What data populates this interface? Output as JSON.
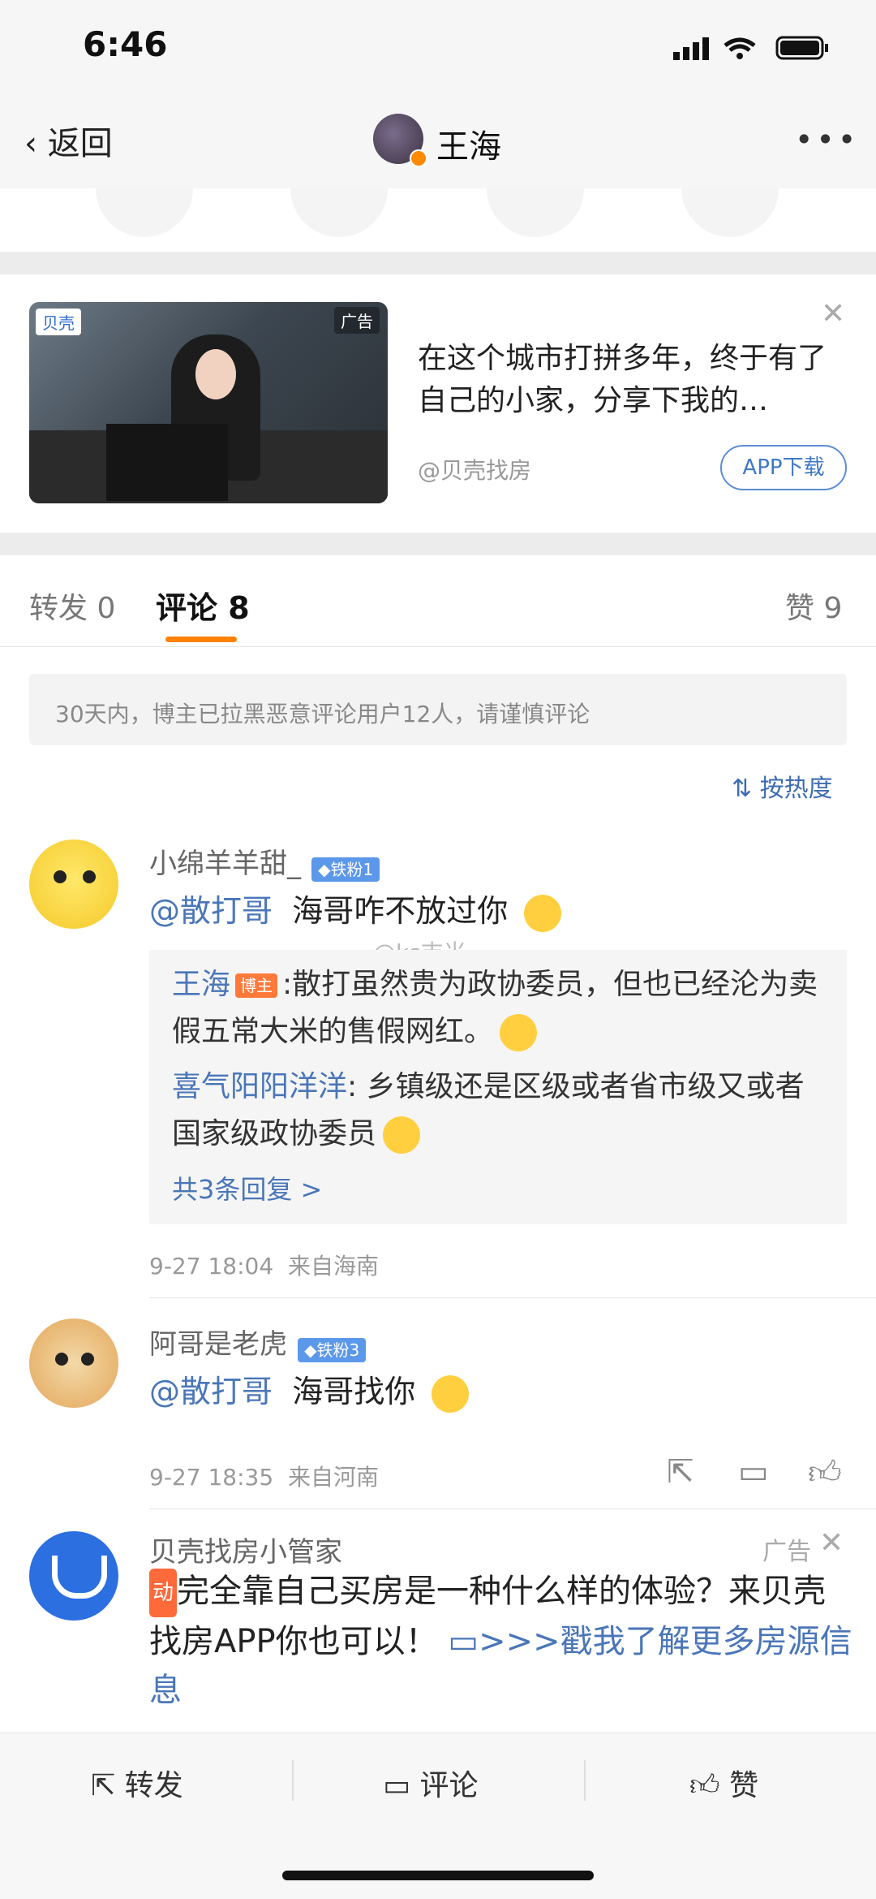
{
  "status_bar": {
    "time": "6:46"
  },
  "nav": {
    "back_label": "返回",
    "title": "王海",
    "more": "•••"
  },
  "ad_card": {
    "logo": "贝壳",
    "ad_tag": "广告",
    "text": "在这个城市打拼多年，终于有了自己的小家，分享下我的…",
    "source": "@贝壳找房",
    "button": "APP下载"
  },
  "tabs": {
    "forward": "转发 0",
    "comments": "评论 8",
    "likes": "赞 9"
  },
  "notice": "30天内，博主已拉黑恶意评论用户12人，请谨慎评论",
  "sort_label": "按热度",
  "watermark": "@ks吉米",
  "comments": [
    {
      "user": "小绵羊羊甜_",
      "badge": "◆铁粉1",
      "mention": "@散打哥",
      "text": "海哥咋不放过你",
      "replies": [
        {
          "user": "王海",
          "host_badge": "博主",
          "text": ":散打虽然贵为政协委员，但也已经沦为卖假五常大米的售假网红。"
        },
        {
          "user": "喜气阳阳洋洋",
          "text": ": 乡镇级还是区级或者省市级又或者国家级政协委员"
        }
      ],
      "more_replies": "共3条回复 >",
      "time": "9-27 18:04",
      "location": "来自海南"
    },
    {
      "user": "阿哥是老虎",
      "badge": "◆铁粉3",
      "mention": "@散打哥",
      "text": "海哥找你",
      "time": "9-27 18:35",
      "location": "来自河南"
    }
  ],
  "ad_comment": {
    "user": "贝壳找房小管家",
    "ad_label": "广告",
    "badge": "动",
    "text": "完全靠自己买房是一种什么样的体验？来贝壳找房APP你也可以！",
    "link": ">>>戳我了解更多房源信息"
  },
  "bottom_bar": {
    "forward": "转发",
    "comment": "评论",
    "like": "赞"
  }
}
